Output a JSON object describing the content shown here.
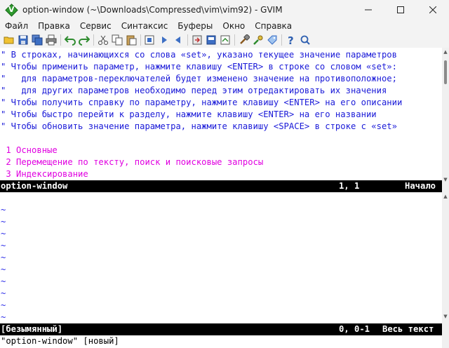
{
  "window": {
    "title": "option-window (~\\Downloads\\Compressed\\vim\\vim92) - GVIM"
  },
  "menu": [
    "Файл",
    "Правка",
    "Сервис",
    "Синтаксис",
    "Буферы",
    "Окно",
    "Справка"
  ],
  "toolbar": {
    "icons": [
      "open-icon",
      "save-icon",
      "save-all-icon",
      "print-icon",
      "undo-icon",
      "redo-icon",
      "cut-icon",
      "copy-icon",
      "paste-icon",
      "find-replace-icon",
      "find-next-icon",
      "find-prev-icon",
      "load-session-icon",
      "save-session-icon",
      "run-script-icon",
      "make-icon",
      "run-ctags-icon",
      "tag-jump-icon",
      "help-icon",
      "find-help-icon"
    ]
  },
  "editor": {
    "help_lines": [
      "\" В строках, начинающихся со слова «set», указано текущее значение параметров",
      "\" Чтобы применить параметр, нажмите клавишу <ENTER> в строке со словом «set»:",
      "\"   для параметров-переключателей будет изменено значение на противоположное;",
      "\"   для других параметров необходимо перед этим отредактировать их значения",
      "\" Чтобы получить справку по параметру, нажмите клавишу <ENTER> на его описании",
      "\" Чтобы быстро перейти к разделу, нажмите клавишу <ENTER> на его названии",
      "\" Чтобы обновить значение параметра, нажмите клавишу <SPACE> в строке с «set»"
    ],
    "sections": [
      " 1 Основные",
      " 2 Перемещение по тексту, поиск и поисковые запросы",
      " 3 Индексирование"
    ],
    "status_top": {
      "name": "option-window",
      "position": "1, 1",
      "scroll": "Начало"
    },
    "tilde": "~",
    "status_bottom": {
      "name": "[безымянный]",
      "position": "0, 0-1",
      "scroll": "Весь текст"
    },
    "cmdline": "\"option-window\" [новый]"
  }
}
